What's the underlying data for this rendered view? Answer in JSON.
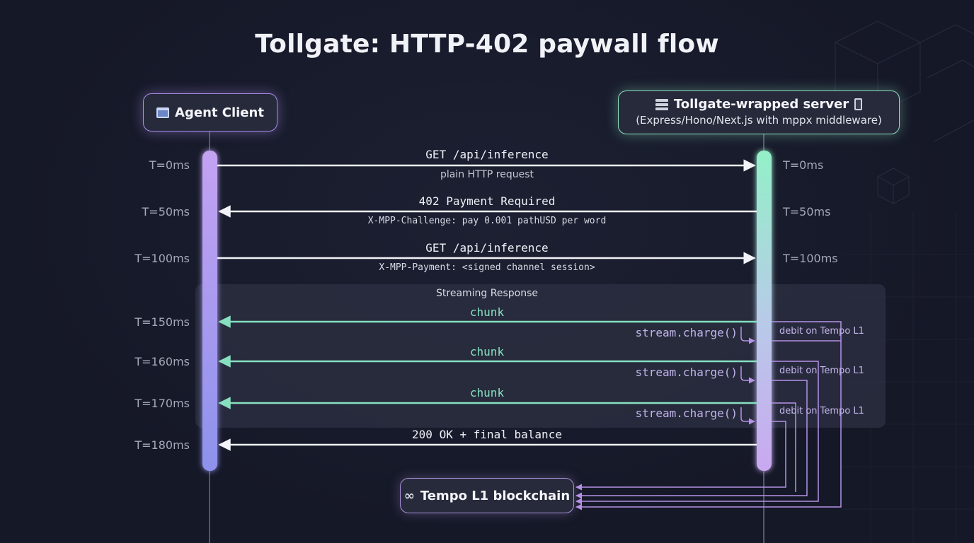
{
  "title": "Tollgate: HTTP-402 paywall flow",
  "actors": {
    "client": {
      "label": "Agent Client",
      "icon": "app-window-icon"
    },
    "server": {
      "label": "Tollgate-wrapped server",
      "subtitle": "(Express/Hono/Next.js with mppx middleware)",
      "icons": [
        "server-rack-icon",
        "phone-icon"
      ]
    },
    "chain": {
      "label": "Tempo L1 blockchain",
      "icon": "link-icon"
    }
  },
  "messages": [
    {
      "label": "GET /api/inference",
      "sublabel": "plain HTTP request",
      "time_client": "T=0ms",
      "time_server": "T=0ms",
      "direction": "client-to-server"
    },
    {
      "label": "402 Payment Required",
      "sublabel": "X-MPP-Challenge: pay 0.001 pathUSD per word",
      "time_client": "T=50ms",
      "time_server": "T=50ms",
      "direction": "server-to-client"
    },
    {
      "label": "GET /api/inference",
      "sublabel": "X-MPP-Payment: <signed channel session>",
      "time_client": "T=100ms",
      "time_server": "T=100ms",
      "direction": "client-to-server"
    }
  ],
  "streaming": {
    "label": "Streaming Response",
    "chunks": [
      {
        "label": "chunk",
        "time": "T=150ms",
        "charge": "stream.charge()",
        "debit": "debit on Tempo L1"
      },
      {
        "label": "chunk",
        "time": "T=160ms",
        "charge": "stream.charge()",
        "debit": "debit on Tempo L1"
      },
      {
        "label": "chunk",
        "time": "T=170ms",
        "charge": "stream.charge()",
        "debit": "debit on Tempo L1"
      }
    ]
  },
  "final": {
    "label": "200 OK + final balance",
    "time": "T=180ms"
  },
  "colors": {
    "background": "#151827",
    "client_accent": "#a98be6",
    "server_accent": "#8ee0c1",
    "chunk": "#86e0c0",
    "charge": "#b592e6",
    "arrow": "#f2f3f8"
  }
}
